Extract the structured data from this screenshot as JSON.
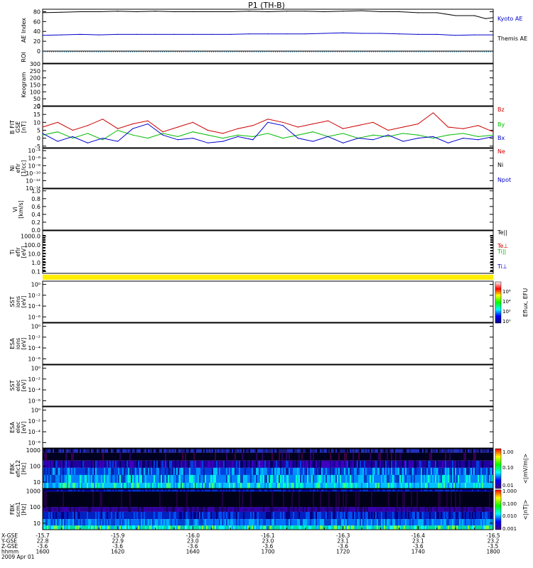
{
  "title": "P1 (TH-B)",
  "date_label": "2009 Apr 01",
  "panels": [
    {
      "id": "ae",
      "ylabel": [
        "AE Index"
      ],
      "ticks": [
        {
          "v": 0,
          "t": "0"
        },
        {
          "v": 20,
          "t": "20"
        },
        {
          "v": 40,
          "t": "40"
        },
        {
          "v": 60,
          "t": "60"
        },
        {
          "v": 80,
          "t": "80"
        }
      ],
      "ylim": [
        0,
        85
      ],
      "log": false,
      "legend": [
        {
          "text": "Kyoto AE",
          "color": "#0000cc"
        },
        {
          "text": "Themis AE",
          "color": "#000000"
        }
      ]
    },
    {
      "id": "roi",
      "ylabel": [
        "ROI"
      ],
      "ticks": [],
      "ylim": [
        0,
        1
      ],
      "log": false,
      "legend": []
    },
    {
      "id": "keogram",
      "ylabel": [
        "Keogram"
      ],
      "ticks": [
        {
          "v": 0,
          "t": "0"
        },
        {
          "v": 50,
          "t": "50"
        },
        {
          "v": 100,
          "t": "100"
        },
        {
          "v": 150,
          "t": "150"
        },
        {
          "v": 200,
          "t": "200"
        },
        {
          "v": 250,
          "t": "250"
        },
        {
          "v": 300,
          "t": "300"
        }
      ],
      "ylim": [
        0,
        300
      ],
      "log": false,
      "legend": []
    },
    {
      "id": "bfit",
      "ylabel": [
        "B FIT",
        "GSE",
        "[nT]"
      ],
      "ticks": [
        {
          "v": -5,
          "t": "-5"
        },
        {
          "v": 0,
          "t": "0"
        },
        {
          "v": 5,
          "t": "5"
        },
        {
          "v": 10,
          "t": "10"
        },
        {
          "v": 15,
          "t": "15"
        },
        {
          "v": 20,
          "t": "20"
        }
      ],
      "ylim": [
        -6,
        20
      ],
      "log": false,
      "legend": [
        {
          "text": "Bz",
          "color": "#cc0000"
        },
        {
          "text": "By",
          "color": "#00bb00"
        },
        {
          "text": "Bx",
          "color": "#0000cc"
        }
      ]
    },
    {
      "id": "ni",
      "ylabel": [
        "Ni",
        "eflr",
        "[1/cc]"
      ],
      "ticks": [
        {
          "v": -14,
          "t": "10⁻¹⁴"
        },
        {
          "v": -12,
          "t": "10⁻¹²"
        },
        {
          "v": -10,
          "t": "10⁻¹⁰"
        },
        {
          "v": -8,
          "t": "10⁻⁸"
        },
        {
          "v": -6,
          "t": "10⁻⁶"
        },
        {
          "v": -4,
          "t": "10⁻⁴"
        }
      ],
      "ylim": [
        -14,
        -3.4
      ],
      "log": true,
      "legend": [
        {
          "text": "Ne",
          "color": "#cc0000"
        },
        {
          "text": "Ni",
          "color": "#000000"
        },
        {
          "text": "Npot",
          "color": "#0000cc"
        }
      ]
    },
    {
      "id": "vi",
      "ylabel": [
        "Vi",
        "[km/s]"
      ],
      "ticks": [
        {
          "v": 0,
          "t": "0.0"
        },
        {
          "v": 0.2,
          "t": "0.2"
        },
        {
          "v": 0.4,
          "t": "0.4"
        },
        {
          "v": 0.6,
          "t": "0.6"
        },
        {
          "v": 0.8,
          "t": "0.8"
        },
        {
          "v": 1.0,
          "t": "1.0"
        }
      ],
      "ylim": [
        0,
        1.05
      ],
      "log": false,
      "legend": []
    },
    {
      "id": "ti",
      "ylabel": [
        "Ti",
        "eflr",
        "[eV]"
      ],
      "ticks": [
        {
          "v": -1,
          "t": "0.1"
        },
        {
          "v": 0,
          "t": "1.0"
        },
        {
          "v": 1,
          "t": "10.0"
        },
        {
          "v": 2,
          "t": "100.0"
        },
        {
          "v": 3,
          "t": "1000.0"
        }
      ],
      "ylim": [
        -1.2,
        3.6
      ],
      "log": true,
      "legend": [
        {
          "text": "Te||",
          "color": "#000000"
        },
        {
          "text": "Te⊥",
          "color": "#cc0000"
        },
        {
          "text": "Ti||",
          "color": "#00bb00"
        },
        {
          "text": "Ti⊥",
          "color": "#0000cc"
        }
      ]
    },
    {
      "id": "sst_i",
      "ylabel": [
        "SST",
        "ions",
        "[eV]"
      ],
      "ticks": [
        {
          "v": -6,
          "t": "10⁻⁶"
        },
        {
          "v": -4,
          "t": "10⁻⁴"
        },
        {
          "v": -2,
          "t": "10⁻²"
        },
        {
          "v": 0,
          "t": "10⁰"
        }
      ],
      "ylim": [
        -7,
        0.6
      ],
      "log": true,
      "legend": []
    },
    {
      "id": "esa_i",
      "ylabel": [
        "ESA",
        "ions",
        "[eV]"
      ],
      "ticks": [
        {
          "v": -6,
          "t": "10⁻⁶"
        },
        {
          "v": -4,
          "t": "10⁻⁴"
        },
        {
          "v": -2,
          "t": "10⁻²"
        },
        {
          "v": 0,
          "t": "10⁰"
        }
      ],
      "ylim": [
        -7,
        0.6
      ],
      "log": true,
      "legend": []
    },
    {
      "id": "sst_e",
      "ylabel": [
        "SST",
        "elec",
        "[eV]"
      ],
      "ticks": [
        {
          "v": -6,
          "t": "10⁻⁶"
        },
        {
          "v": -4,
          "t": "10⁻⁴"
        },
        {
          "v": -2,
          "t": "10⁻²"
        },
        {
          "v": 0,
          "t": "10⁰"
        }
      ],
      "ylim": [
        -7,
        0.6
      ],
      "log": true,
      "legend": []
    },
    {
      "id": "esa_e",
      "ylabel": [
        "ESA",
        "elec",
        "[eV]"
      ],
      "ticks": [
        {
          "v": -6,
          "t": "10⁻⁶"
        },
        {
          "v": -4,
          "t": "10⁻⁴"
        },
        {
          "v": -2,
          "t": "10⁻²"
        },
        {
          "v": 0,
          "t": "10⁰"
        }
      ],
      "ylim": [
        -7,
        0.6
      ],
      "log": true,
      "legend": []
    },
    {
      "id": "fbk_e",
      "ylabel": [
        "FBK",
        "efic12",
        "[Hz]"
      ],
      "ticks": [
        {
          "v": 1,
          "t": "10"
        },
        {
          "v": 2,
          "t": "100"
        },
        {
          "v": 3,
          "t": "1000"
        }
      ],
      "ylim": [
        0.6,
        3.1
      ],
      "log": true,
      "legend": []
    },
    {
      "id": "fbk_b",
      "ylabel": [
        "FBK",
        "scm1",
        "[Hz]"
      ],
      "ticks": [
        {
          "v": 1,
          "t": "10"
        },
        {
          "v": 2,
          "t": "100"
        },
        {
          "v": 3,
          "t": "1000"
        }
      ],
      "ylim": [
        0.6,
        3.1
      ],
      "log": true,
      "legend": []
    }
  ],
  "colorbars": [
    {
      "id": "eflux",
      "label": "Eflux, EFU",
      "ticks": [
        "10⁰",
        "10²",
        "10⁴",
        "10⁶"
      ]
    },
    {
      "id": "mvm",
      "label": "<|mV/m|>",
      "ticks": [
        "0.01",
        "0.10",
        "1.00"
      ]
    },
    {
      "id": "nt",
      "label": "<|nT|>",
      "ticks": [
        "0.001",
        "0.010",
        "0.100",
        "1.000"
      ]
    }
  ],
  "xaxis": {
    "row_labels": [
      "X-GSE",
      "Y-GSE",
      "Z-GSE",
      "hhmm"
    ],
    "columns": [
      [
        "-15.7",
        "22.8",
        "-3.6",
        "1600"
      ],
      [
        "-15.9",
        "22.9",
        "-3.6",
        "1620"
      ],
      [
        "-16.0",
        "23.0",
        "-3.6",
        "1640"
      ],
      [
        "-16.1",
        "23.0",
        "-3.6",
        "1700"
      ],
      [
        "-16.3",
        "23.1",
        "-3.6",
        "1720"
      ],
      [
        "-16.4",
        "23.1",
        "-3.6",
        "1740"
      ],
      [
        "-16.5",
        "23.2",
        "-3.5",
        "1800"
      ]
    ]
  },
  "chart_data": [
    {
      "type": "line",
      "panel": "ae",
      "x_unit": "min since 1600",
      "xlim": [
        0,
        120
      ],
      "ylim": [
        0,
        85
      ],
      "series": [
        {
          "name": "Themis AE",
          "color": "#000000",
          "x": [
            0,
            5,
            10,
            15,
            20,
            25,
            30,
            35,
            40,
            45,
            50,
            55,
            60,
            65,
            70,
            75,
            80,
            85,
            90,
            95,
            100,
            105,
            110,
            115,
            118,
            120
          ],
          "values": [
            78,
            79,
            80,
            80,
            81,
            80,
            81,
            80,
            80,
            80,
            80,
            81,
            80,
            81,
            81,
            80,
            81,
            82,
            80,
            80,
            78,
            78,
            72,
            72,
            66,
            68
          ]
        },
        {
          "name": "Kyoto AE",
          "color": "#0000cc",
          "x": [
            0,
            5,
            10,
            15,
            20,
            25,
            30,
            35,
            40,
            45,
            50,
            55,
            60,
            65,
            70,
            75,
            80,
            85,
            90,
            95,
            100,
            105,
            110,
            115,
            120
          ],
          "values": [
            32,
            33,
            34,
            33,
            34,
            34,
            34,
            34,
            34,
            34,
            34,
            35,
            35,
            35,
            35,
            36,
            37,
            36,
            36,
            35,
            34,
            34,
            32,
            33,
            33
          ]
        }
      ]
    },
    {
      "type": "line",
      "panel": "bfit",
      "x_unit": "min since 1600",
      "xlim": [
        0,
        120
      ],
      "ylim": [
        -6,
        20
      ],
      "series": [
        {
          "name": "Bz",
          "color": "#cc0000",
          "x": [
            0,
            4,
            8,
            12,
            16,
            20,
            24,
            28,
            32,
            36,
            40,
            44,
            48,
            52,
            56,
            60,
            64,
            68,
            72,
            76,
            80,
            84,
            88,
            92,
            96,
            100,
            104,
            108,
            112,
            116,
            120
          ],
          "values": [
            7,
            10,
            5,
            8,
            12,
            6,
            9,
            11,
            4,
            7,
            10,
            5,
            3,
            6,
            8,
            12,
            10,
            7,
            9,
            11,
            6,
            8,
            10,
            5,
            7,
            9,
            16,
            7,
            6,
            8,
            4
          ]
        },
        {
          "name": "By",
          "color": "#00bb00",
          "x": [
            0,
            4,
            8,
            12,
            16,
            20,
            24,
            28,
            32,
            36,
            40,
            44,
            48,
            52,
            56,
            60,
            64,
            68,
            72,
            76,
            80,
            84,
            88,
            92,
            96,
            100,
            104,
            108,
            112,
            116,
            120
          ],
          "values": [
            2,
            4,
            0,
            3,
            -1,
            5,
            2,
            0,
            3,
            1,
            4,
            2,
            0,
            2,
            1,
            3,
            0,
            2,
            4,
            1,
            3,
            0,
            2,
            1,
            3,
            2,
            0,
            2,
            3,
            1,
            2
          ]
        },
        {
          "name": "Bx",
          "color": "#0000cc",
          "x": [
            0,
            4,
            8,
            12,
            16,
            20,
            24,
            28,
            32,
            36,
            40,
            44,
            48,
            52,
            56,
            60,
            64,
            68,
            72,
            76,
            80,
            84,
            88,
            92,
            96,
            100,
            104,
            108,
            112,
            116,
            120
          ],
          "values": [
            3,
            -2,
            1,
            -3,
            0,
            -2,
            6,
            9,
            2,
            -1,
            0,
            -3,
            -2,
            1,
            -1,
            10,
            8,
            0,
            -2,
            1,
            -3,
            0,
            -1,
            2,
            -2,
            0,
            1,
            -3,
            0,
            -1,
            1
          ]
        }
      ]
    }
  ]
}
